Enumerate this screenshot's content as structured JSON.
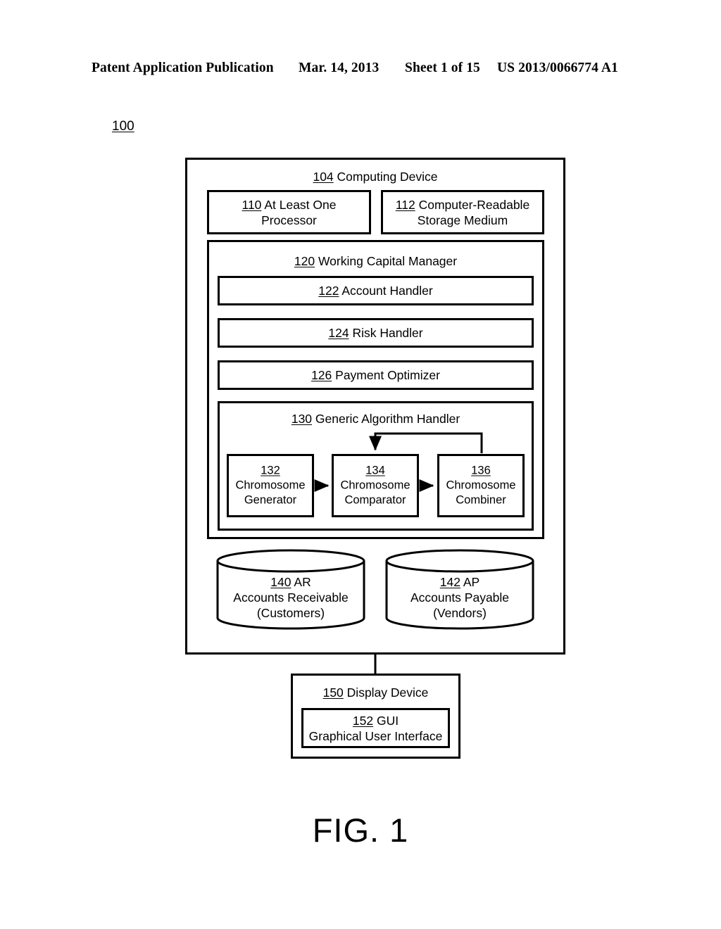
{
  "header": {
    "publication": "Patent Application Publication",
    "date": "Mar. 14, 2013",
    "sheet": "Sheet 1 of 15",
    "patent_number": "US 2013/0066774 A1"
  },
  "figure": {
    "system_ref": "100",
    "caption": "FIG. 1"
  },
  "computing_device": {
    "ref": "104",
    "label": "Computing Device"
  },
  "processor": {
    "ref": "110",
    "label": "At Least One Processor",
    "line1": "At Least One",
    "line2": "Processor"
  },
  "storage": {
    "ref": "112",
    "label": "Computer-Readable Storage Medium",
    "line1": "Computer-Readable",
    "line2": "Storage Medium"
  },
  "working_capital_manager": {
    "ref": "120",
    "label": "Working Capital Manager",
    "components": [
      {
        "ref": "122",
        "label": "Account Handler"
      },
      {
        "ref": "124",
        "label": "Risk Handler"
      },
      {
        "ref": "126",
        "label": "Payment Optimizer"
      }
    ]
  },
  "generic_algorithm_handler": {
    "ref": "130",
    "label": "Generic Algorithm Handler",
    "components": [
      {
        "ref": "132",
        "line1": "Chromosome",
        "line2": "Generator"
      },
      {
        "ref": "134",
        "line1": "Chromosome",
        "line2": "Comparator"
      },
      {
        "ref": "136",
        "line1": "Chromosome",
        "line2": "Combiner"
      }
    ]
  },
  "databases": [
    {
      "ref": "140",
      "line1": "AR",
      "line2": "Accounts Receivable",
      "line3": "(Customers)"
    },
    {
      "ref": "142",
      "line1": "AP",
      "line2": "Accounts Payable",
      "line3": "(Vendors)"
    }
  ],
  "display_device": {
    "ref": "150",
    "label": "Display Device"
  },
  "gui": {
    "ref": "152",
    "line1": "GUI",
    "line2": "Graphical User Interface"
  },
  "colors": {
    "ink": "#000000",
    "paper": "#ffffff"
  }
}
